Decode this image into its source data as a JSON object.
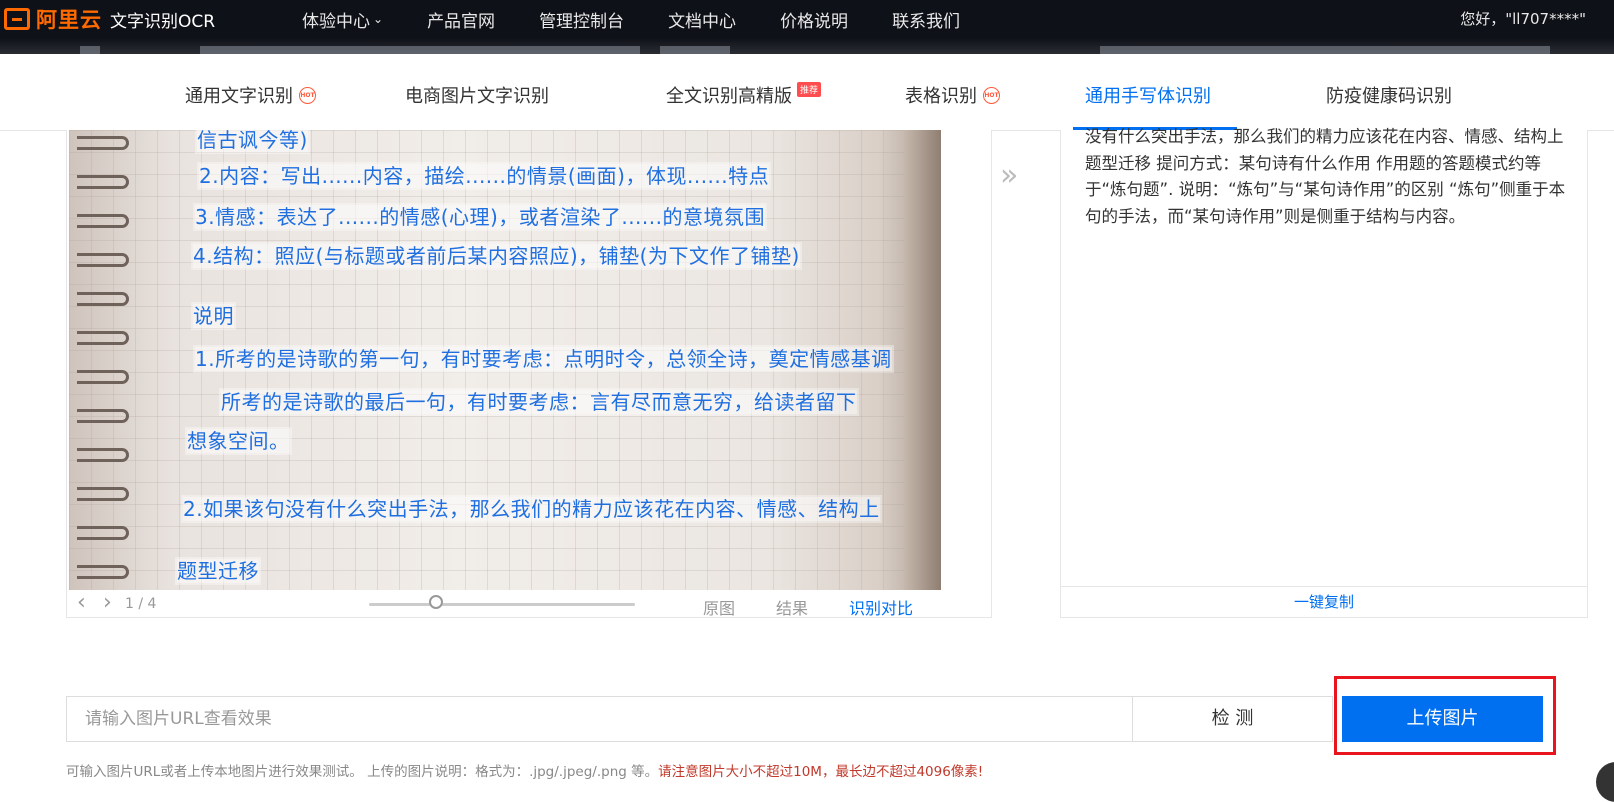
{
  "brand": {
    "logo": "阿里云",
    "product": "文字识别OCR"
  },
  "topnav": {
    "items": [
      {
        "label": "体验中心",
        "has_caret": true
      },
      {
        "label": "产品官网"
      },
      {
        "label": "管理控制台"
      },
      {
        "label": "文档中心"
      },
      {
        "label": "价格说明"
      },
      {
        "label": "联系我们"
      }
    ],
    "greeting": "您好，\"ll707****\""
  },
  "tabs": [
    {
      "label": "通用文字识别",
      "badge": "hot"
    },
    {
      "label": "电商图片文字识别"
    },
    {
      "label": "全文识别高精版",
      "badge": "推荐"
    },
    {
      "label": "表格识别",
      "badge": "hot"
    },
    {
      "label": "通用手写体识别",
      "active": true
    },
    {
      "label": "防疫健康码识别"
    }
  ],
  "viewer": {
    "lines": [
      "信古讽今等)",
      "2.内容：写出......内容，描绘......的情景(画面)，体现......特点",
      "3.情感：表达了......的情感(心理)，或者渲染了......的意境氛围",
      "4.结构：照应(与标题或者前后某内容照应)，铺垫(为下文作了铺垫)",
      "说明",
      "1.所考的是诗歌的第一句，有时要考虑：点明时令，总领全诗，奠定情感基调",
      "所考的是诗歌的最后一句，有时要考虑：言有尽而意无穷，给读者留下",
      "想象空间。",
      "2.如果该句没有什么突出手法，那么我们的精力应该花在内容、情感、结构上",
      "题型迁移"
    ],
    "page": "1 / 4",
    "slider_value": 0.25,
    "options": [
      "原图",
      "结果",
      "识别对比"
    ],
    "active_option": "识别对比"
  },
  "result": {
    "text": "没有什么突出手法，那么我们的精力应该花在内容、情感、结构上 题型迁移 提问方式：某句诗有什么作用 作用题的答题模式约等于“炼句题”. 说明：“炼句”与“某句诗作用”的区别 “炼句”侧重于本句的手法，而“某句诗作用”则是侧重于结构与内容。",
    "copy_label": "一键复制"
  },
  "url_area": {
    "placeholder": "请输入图片URL查看效果",
    "detect_label": "检 测",
    "upload_label": "上传图片",
    "hint_plain": "可输入图片URL或者上传本地图片进行效果测试。 上传的图片说明：格式为：.jpg/.jpeg/.png 等。",
    "hint_warn": "请注意图片大小不超过10M，最长边不超过4096像素!"
  },
  "colors": {
    "accent": "#0070f0",
    "brand_orange": "#ff6a00",
    "highlight_red": "#e8141e",
    "topbar_bg": "#0e1117"
  }
}
